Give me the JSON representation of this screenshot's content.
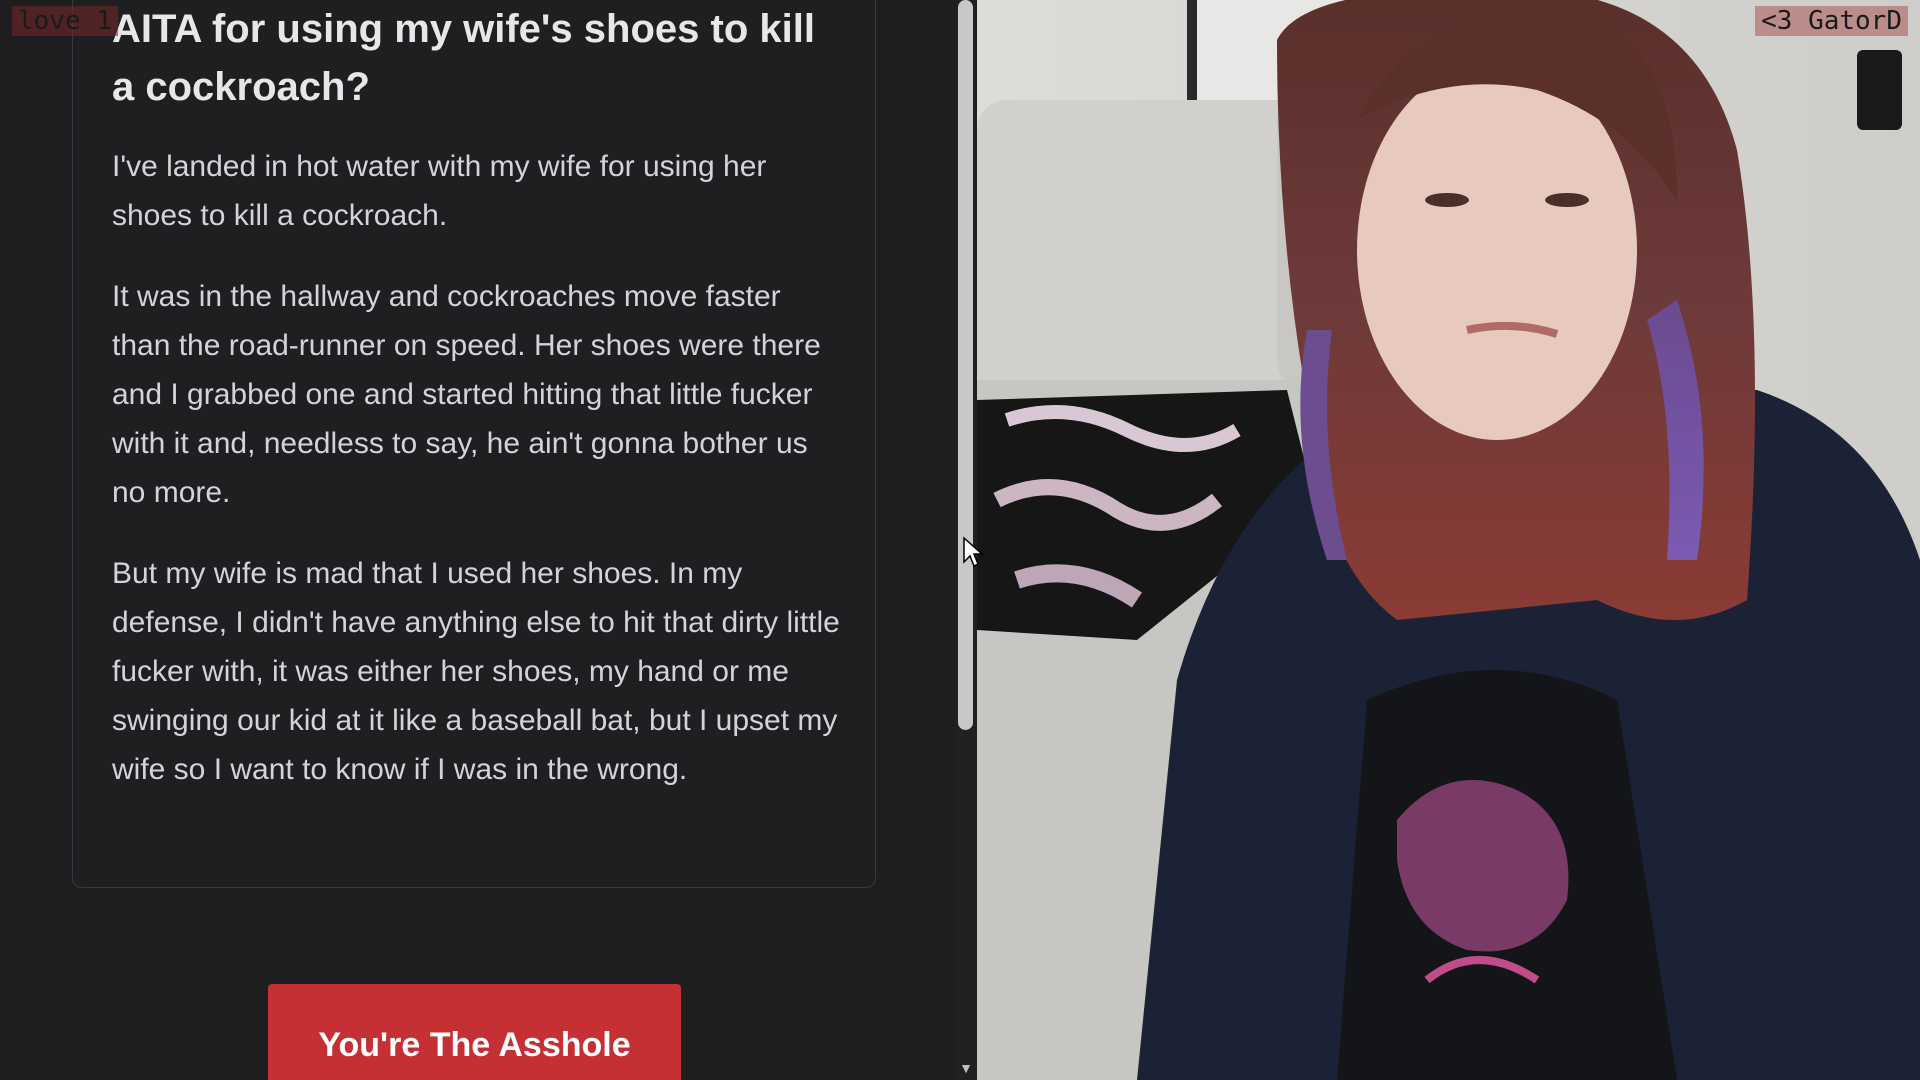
{
  "overlay": {
    "top_left_text": "love 1",
    "top_right_text": "<3 GatorD"
  },
  "post": {
    "title": "AITA for using my wife's shoes to kill a cockroach?",
    "paragraphs": [
      "I've landed in hot water with my wife for using her shoes to kill a cockroach.",
      "It was in the hallway and cockroaches move faster than the road-runner on speed. Her shoes were there and I grabbed one and started hitting that little fucker with it and, needless to say, he ain't gonna bother us no more.",
      "But my wife is mad that I used her shoes. In my defense, I didn't have anything else to hit that dirty little fucker with, it was either her shoes, my hand or me swinging our kid at it like a baseball bat, but I upset my wife so I want to know if I was in the wrong."
    ]
  },
  "verdict": {
    "button_label": "You're The Asshole",
    "button_color": "#c53035"
  },
  "icons": {
    "cursor": "mouse-pointer-icon",
    "scroll_down": "chevron-down-icon"
  },
  "webcam": {
    "description_label": "webcam-feed"
  }
}
